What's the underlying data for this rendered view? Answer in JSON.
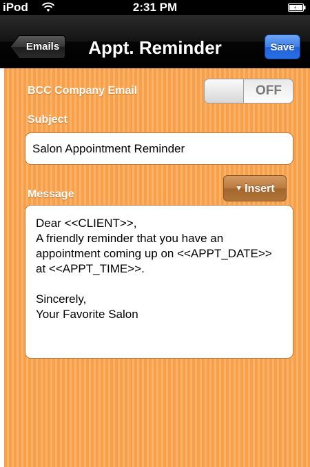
{
  "status_bar": {
    "carrier": "iPod",
    "time": "2:31 PM",
    "icons": [
      "wifi-icon",
      "battery-icon"
    ]
  },
  "nav": {
    "back_label": "Emails",
    "title": "Appt. Reminder",
    "save_label": "Save"
  },
  "form": {
    "bcc_label": "BCC Company Email",
    "bcc_toggle_state": "OFF",
    "subject_label": "Subject",
    "subject_value": "Salon Appointment Reminder",
    "message_label": "Message",
    "insert_label": "Insert",
    "insert_icon": "triangle-down-icon",
    "message_value": "Dear <<CLIENT>>,\nA friendly reminder that you have an appointment coming up on <<APPT_DATE>> at <<APPT_TIME>>.\n\nSincerely,\nYour Favorite Salon"
  },
  "colors": {
    "background": "#f7a04c",
    "save_button": "#2a6ee4",
    "insert_button": "#b07438"
  }
}
